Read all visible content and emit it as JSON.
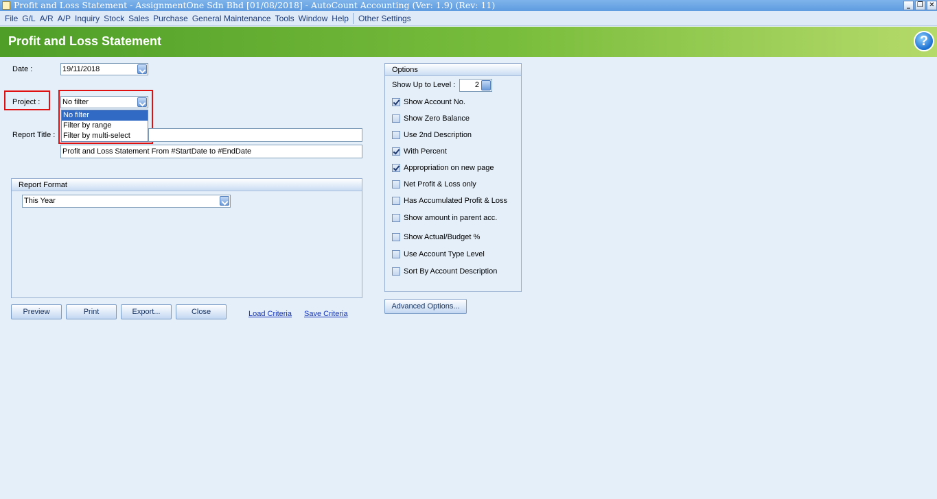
{
  "window": {
    "title": "Profit and Loss Statement - AssignmentOne Sdn Bhd [01/08/2018] - AutoCount Accounting (Ver: 1.9) (Rev: 11)",
    "minimize": "_",
    "restore": "❐",
    "close": "✕"
  },
  "menu": {
    "items": [
      "File",
      "G/L",
      "A/R",
      "A/P",
      "Inquiry",
      "Stock",
      "Sales",
      "Purchase",
      "General Maintenance",
      "Tools",
      "Window",
      "Help"
    ],
    "extra": "Other Settings"
  },
  "header": {
    "title": "Profit and Loss Statement",
    "help": "?"
  },
  "form": {
    "date_label": "Date :",
    "date_value": "19/11/2018",
    "project_label": "Project :",
    "project_value": "No filter",
    "project_options": [
      "No filter",
      "Filter by range",
      "Filter by multi-select"
    ],
    "report_title_label": "Report Title :",
    "report_title_line1": "",
    "report_title_line2": "Profit and Loss Statement From #StartDate to #EndDate"
  },
  "report_format": {
    "header": "Report Format",
    "value": "This Year"
  },
  "options": {
    "header": "Options",
    "level_label": "Show Up to Level :",
    "level_value": "2",
    "checks": [
      {
        "label": "Show Account No.",
        "checked": true
      },
      {
        "label": "Show Zero Balance",
        "checked": false
      },
      {
        "label": "Use 2nd Description",
        "checked": false
      },
      {
        "label": "With Percent",
        "checked": true
      },
      {
        "label": "Appropriation on new page",
        "checked": true
      },
      {
        "label": "Net Profit & Loss only",
        "checked": false
      },
      {
        "label": "Has Accumulated Profit & Loss",
        "checked": false
      },
      {
        "label": "Show amount in parent acc.",
        "checked": false
      },
      {
        "label": "Show Actual/Budget %",
        "checked": false
      },
      {
        "label": "Use Account Type Level",
        "checked": false
      },
      {
        "label": "Sort By Account Description",
        "checked": false
      }
    ],
    "advanced": "Advanced Options..."
  },
  "buttons": {
    "preview": "Preview",
    "print": "Print",
    "export": "Export...",
    "close": "Close",
    "load_criteria": "Load Criteria",
    "save_criteria": "Save Criteria"
  }
}
